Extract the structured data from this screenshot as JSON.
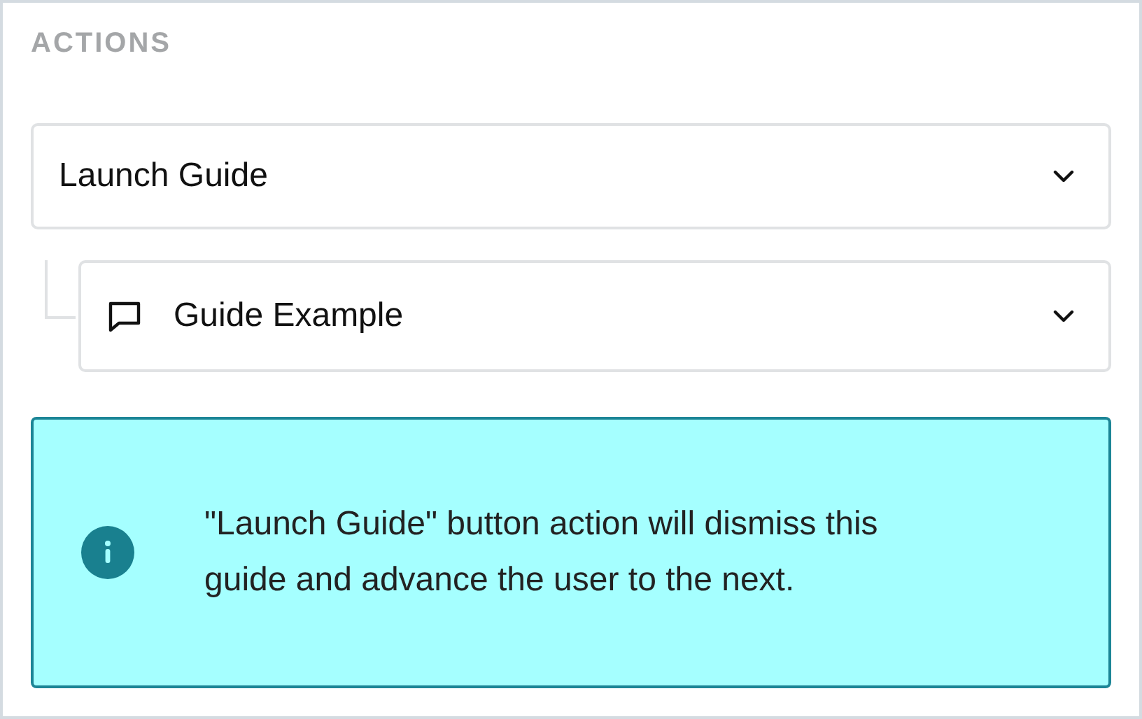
{
  "section_title": "ACTIONS",
  "action_select": {
    "value": "Launch Guide"
  },
  "guide_select": {
    "value": "Guide Example"
  },
  "info_message": "\"Launch Guide\" button action will dismiss this guide and advance the user to the next."
}
